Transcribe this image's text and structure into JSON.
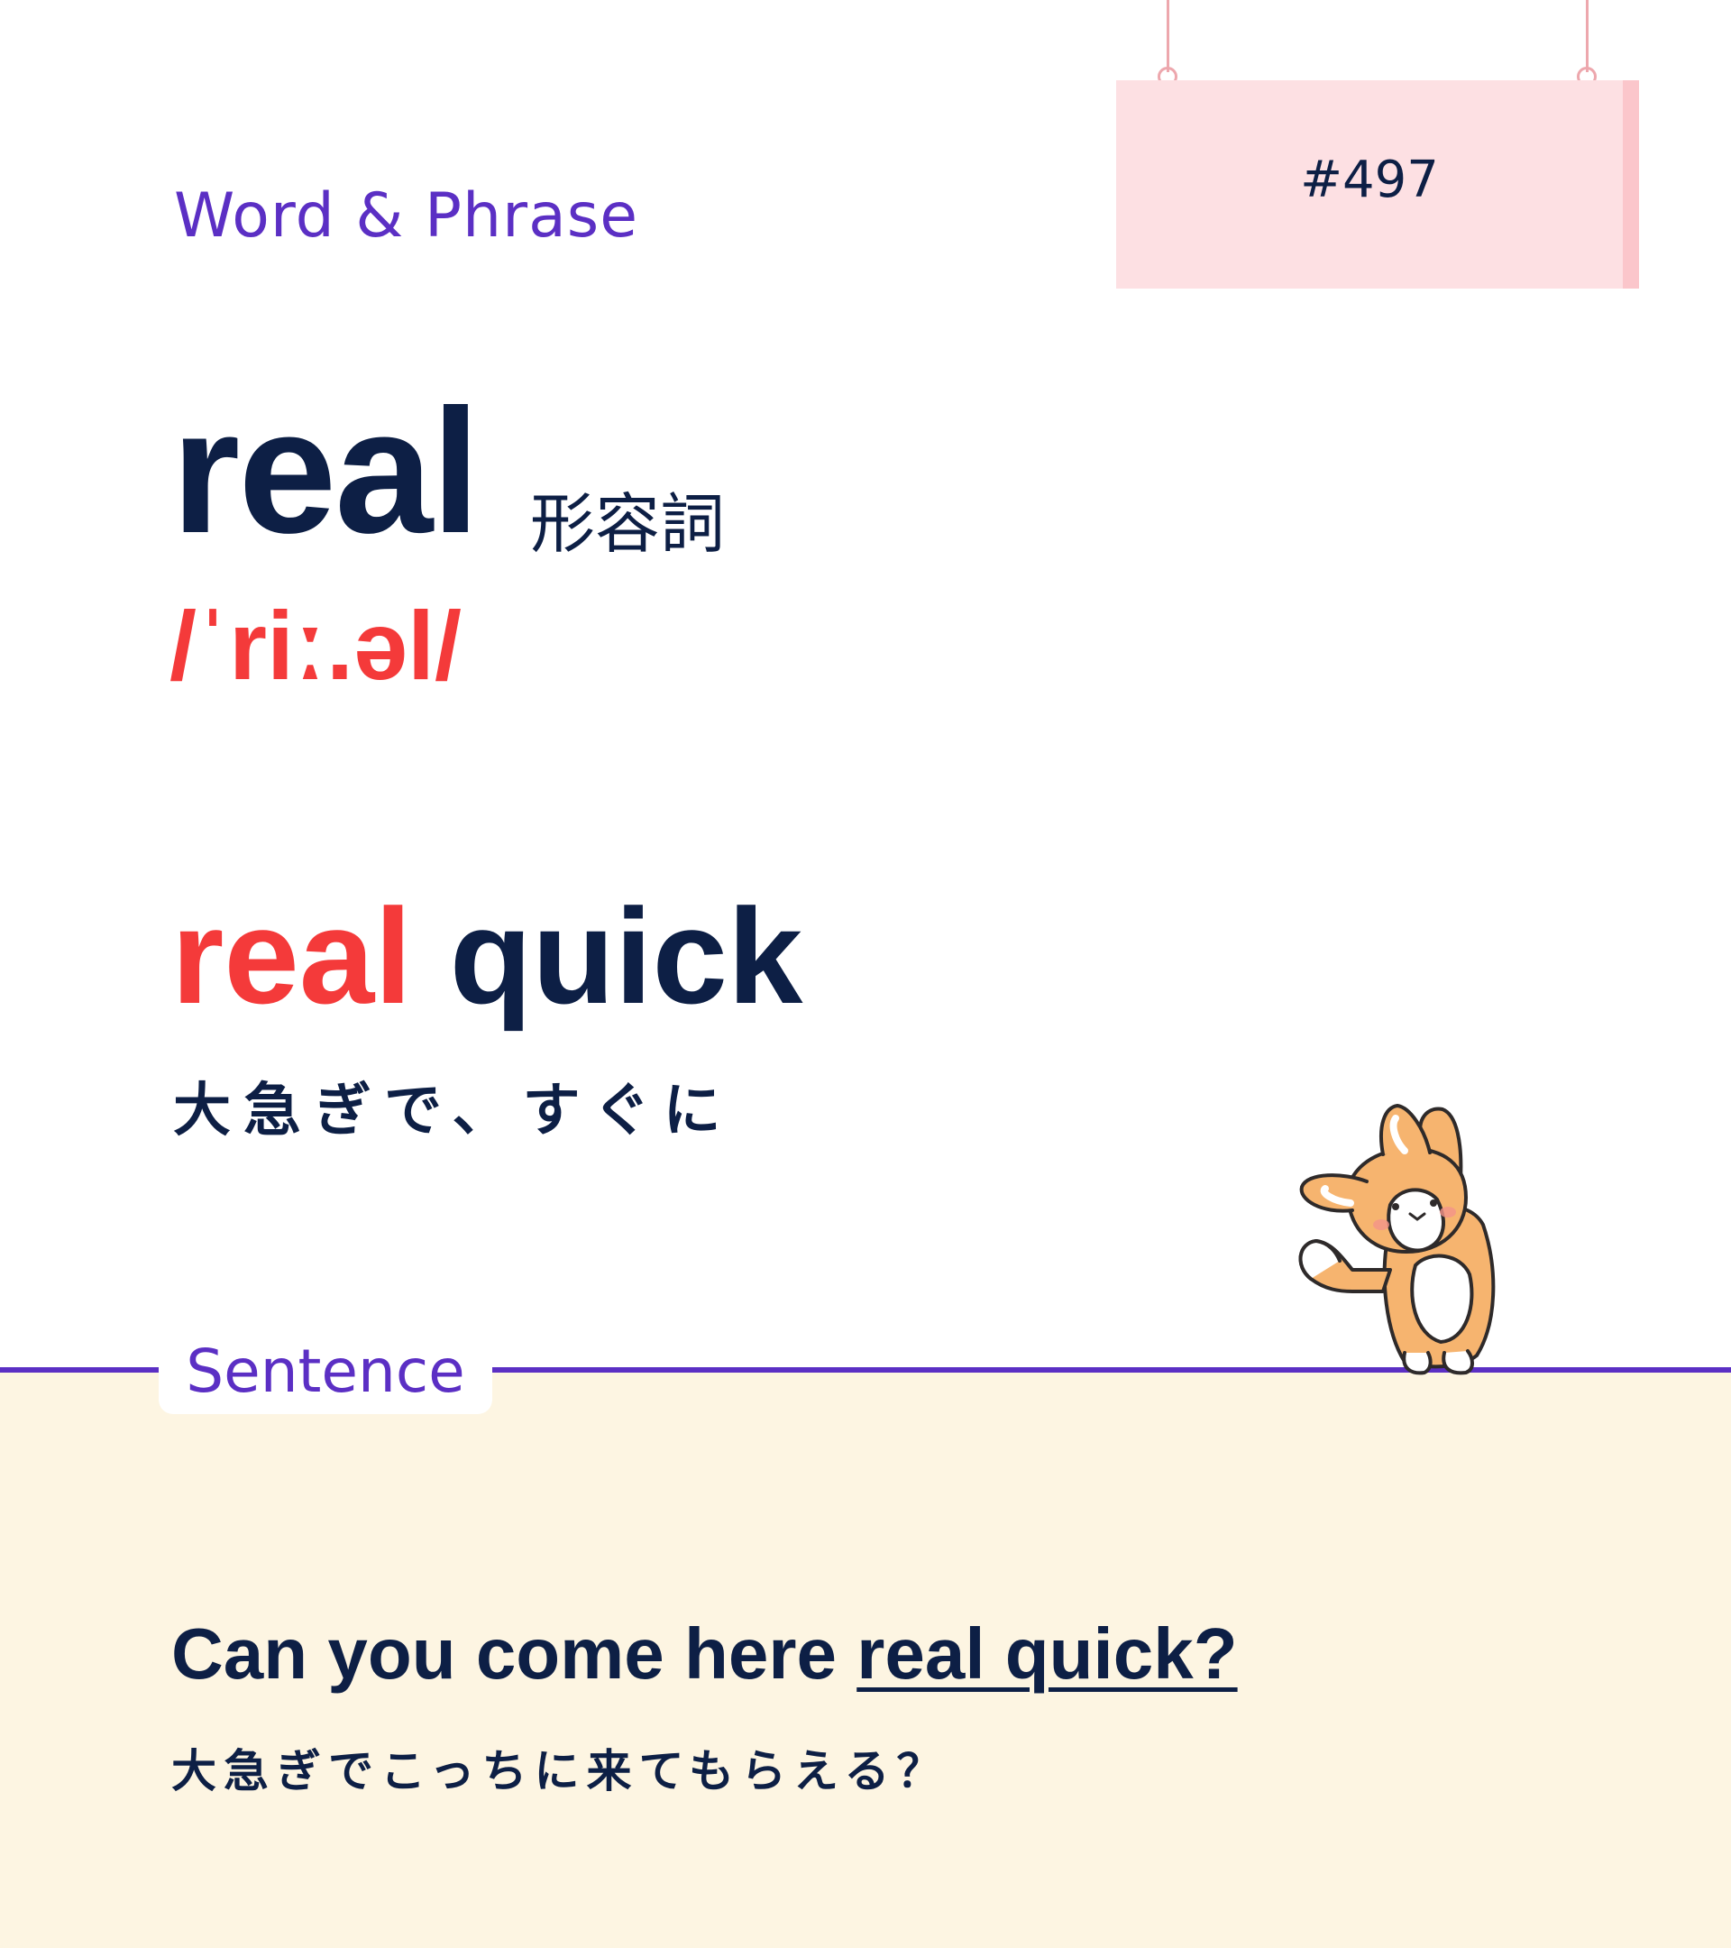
{
  "category": "Word & Phrase",
  "entry_number": "#497",
  "word": {
    "headword": "real",
    "part_of_speech": "形容詞",
    "pronunciation": "/ˈriː.əl/"
  },
  "phrase": {
    "highlight": "real",
    "rest": "quick",
    "meaning": "大急ぎで、すぐに"
  },
  "section": {
    "label": "Sentence"
  },
  "example": {
    "prefix": "Can you come here ",
    "highlight": "real quick?",
    "translation": "大急ぎでこっちに来てもらえる？"
  },
  "colors": {
    "accent_purple": "#5b2fc4",
    "accent_red": "#f43a3a",
    "text_navy": "#0d1f45",
    "sign_pink": "#fde0e3",
    "panel_cream": "#fdf5e2"
  },
  "icons": {
    "mascot": "corgi-mascot-icon"
  }
}
